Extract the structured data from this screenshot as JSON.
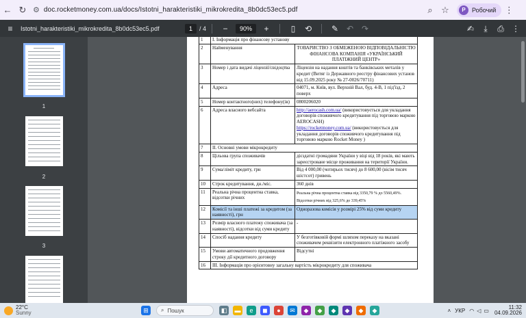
{
  "browser": {
    "url": "doc.rocketmoney.com.ua/docs/Istotni_harakteristiki_mikrokredita_8b0dc53ec5.pdf",
    "profile_initial": "Р",
    "profile_label": "Робочий"
  },
  "pdf": {
    "filename": "Istotni_harakteristiki_mikrokredita_8b0dc53ec5.pdf",
    "page_current": "1",
    "page_total": "/ 4",
    "zoom": "90%"
  },
  "thumbnails": [
    {
      "num": "1"
    },
    {
      "num": "2"
    },
    {
      "num": "3"
    }
  ],
  "table": {
    "rows": [
      {
        "n": "1",
        "k": "I. Інформація про фінансову установу",
        "full": true
      },
      {
        "n": "2",
        "k": "Найменування",
        "v": "ТОВАРИСТВО З ОБМЕЖЕНОЮ ВІДПОВІДАЛЬНІСТЮ ФІНАНСОВА КОМПАНІЯ «УКРАЇНСЬКИЙ ПЛАТІЖНИЙ ЦЕНТР»",
        "center": true
      },
      {
        "n": "3",
        "k": "Номер і дата видачі ліцензії/свідоцтва",
        "v": "Ліцензія на надання коштів та банківських металів у кредит (Витяг із Державного реєстру фінансових установ від 15.09.2025 року № 27-0026/70711)"
      },
      {
        "n": "4",
        "k": "Адреса",
        "v": "04071, м. Київ, вул. Верхній Вал, буд. 4-В, 1 під'їзд, 2 поверх"
      },
      {
        "n": "5",
        "k": "Номер контактного(них) телефону(ів)",
        "v": "0800206020"
      },
      {
        "n": "6",
        "k": "Адреса власного вебсайта",
        "link1": "http://aerocash.com.ua/",
        "v1": " (використовується для укладання договорів споживчого кредитування під торговою маркою AEROCASH)",
        "link2": "https://rocketmoney.com.ua/",
        "v2": " (використовується для укладання договорів споживчого кредитування під торговою маркою Rocket Money )"
      },
      {
        "n": "7",
        "k": "II. Основні умови мікрокредиту",
        "full": true
      },
      {
        "n": "8",
        "k": "Цільова група споживачів",
        "v": "дієздатні громадяни України у віці від 18 років, які мають зареєстроване місце проживання на території України."
      },
      {
        "n": "9",
        "k": "Сума/ліміт кредиту, грн",
        "v": "Від 4 000,00 (чотирьох тисяч) до 8 600,00 (вісім тисяч шістсот) гривень"
      },
      {
        "n": "10",
        "k": "Строк кредитування, дн./міс.",
        "v": "360 днів"
      },
      {
        "n": "11",
        "k": "Реальна річна процентна ставка, відсотки річних",
        "v": "Реальна річна процентна ставка від 3350,79 % до 5560,49%.",
        "v_extra": "Відсотки річних від 325,6% до 339,45%",
        "small": true
      },
      {
        "n": "12",
        "k": "Комісії та інші платежі за кредитом (за наявності), грн",
        "v": "Одноразова комісія у розмірі 25% від суми кредиту",
        "highlight": true
      },
      {
        "n": "13",
        "k": "Розмір власного платежу споживача (за наявності), відсотки від суми кредиту",
        "v": "-"
      },
      {
        "n": "14",
        "k": "Спосіб надання кредиту",
        "v": "У безготівковій формі шляхом переказу на вказані споживачем реквізити електронного платіжного засобу"
      },
      {
        "n": "15",
        "k": "Умови автоматичного продовження строку дії кредитного договору",
        "v": "Відсутні"
      },
      {
        "n": "16",
        "k": "III. Інформація про орієнтовну загальну вартість мікрокредиту для споживача",
        "full": true
      }
    ]
  },
  "taskbar": {
    "temp": "22°C",
    "weather": "Sunny",
    "search": "Пошук",
    "lang": "УКР",
    "time": "11:32",
    "date": "04.09.2026"
  }
}
